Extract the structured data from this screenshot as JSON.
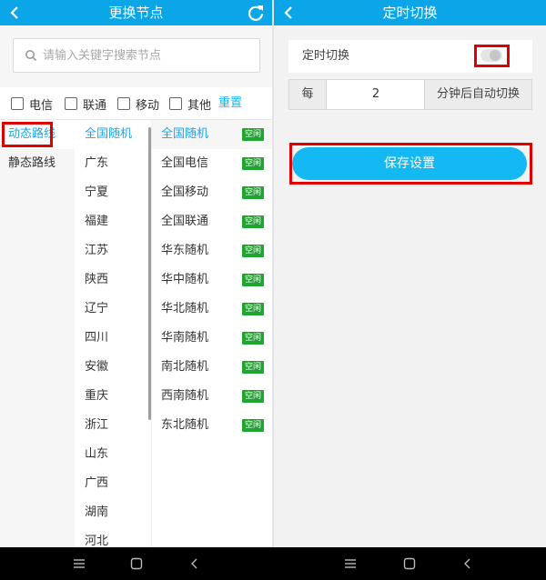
{
  "left": {
    "title": "更换节点",
    "search_placeholder": "请输入关键字搜索节点",
    "filters": [
      "电信",
      "联通",
      "移动",
      "其他"
    ],
    "reset_label": "重置",
    "route_types": [
      {
        "label": "动态路线",
        "active": true
      },
      {
        "label": "静态路线",
        "active": false
      }
    ],
    "regions": [
      "全国随机",
      "广东",
      "宁夏",
      "福建",
      "江苏",
      "陕西",
      "辽宁",
      "四川",
      "安徽",
      "重庆",
      "浙江",
      "山东",
      "广西",
      "湖南",
      "河北"
    ],
    "nodes": [
      {
        "name": "全国随机",
        "status": "空闲",
        "active": true
      },
      {
        "name": "全国电信",
        "status": "空闲"
      },
      {
        "name": "全国移动",
        "status": "空闲"
      },
      {
        "name": "全国联通",
        "status": "空闲"
      },
      {
        "name": "华东随机",
        "status": "空闲"
      },
      {
        "name": "华中随机",
        "status": "空闲"
      },
      {
        "name": "华北随机",
        "status": "空闲"
      },
      {
        "name": "华南随机",
        "status": "空闲"
      },
      {
        "name": "南北随机",
        "status": "空闲"
      },
      {
        "name": "西南随机",
        "status": "空闲"
      },
      {
        "name": "东北随机",
        "status": "空闲"
      }
    ],
    "accent_color": "#19a6e8",
    "badge_color": "#21a531"
  },
  "right": {
    "title": "定时切换",
    "timer_label": "定时切换",
    "timer_enabled": false,
    "interval_prefix": "每",
    "interval_value": "2",
    "interval_suffix": "分钟后自动切换",
    "save_label": "保存设置",
    "button_color": "#14b8f2"
  },
  "header_color": "#0aa6e8",
  "highlight_color": "#e00000"
}
